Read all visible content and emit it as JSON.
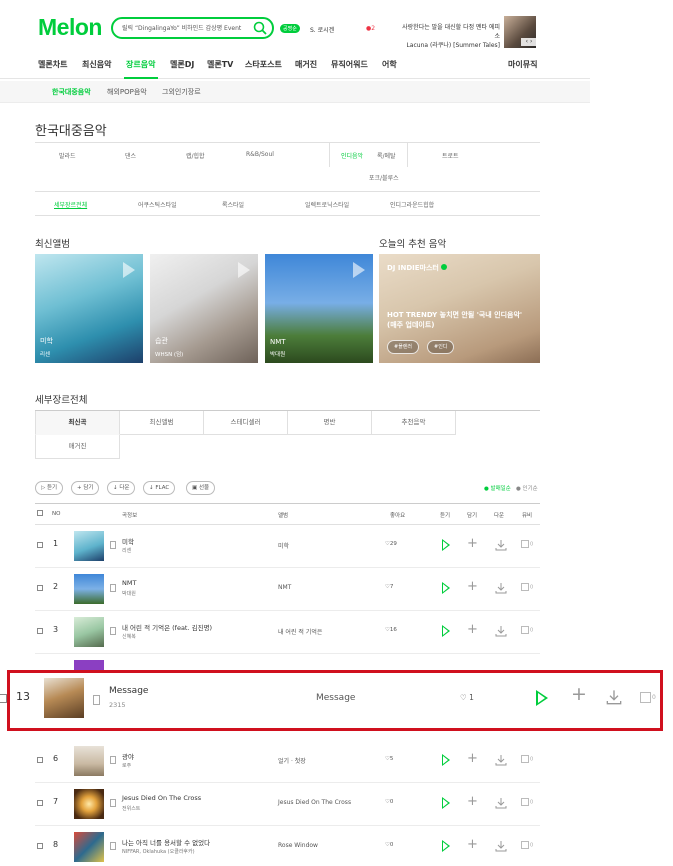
{
  "header": {
    "logo": "Melon",
    "search_placeholder": "릴릭 “DingalingaYo” 비하인드 감상평 Event",
    "badge": "공명순",
    "status_text": "S. 로시겐",
    "dot_text": "●2",
    "promo_line1": "사랑한다는 말을 대신할 다정 멘타 에피소",
    "promo_line2": "Lacuna (라쿠나) [Summer Tales]",
    "promo_nav": "‹ ›"
  },
  "gnb": [
    {
      "label": "멜론차트"
    },
    {
      "label": "최신음악"
    },
    {
      "label": "장르음악"
    },
    {
      "label": "멜론DJ"
    },
    {
      "label": "멜론TV"
    },
    {
      "label": "스타포스트"
    },
    {
      "label": "매거진"
    },
    {
      "label": "뮤직어워드"
    },
    {
      "label": "어학"
    },
    {
      "label": "마이뮤직"
    }
  ],
  "subnav": [
    {
      "label": "한국대중음악"
    },
    {
      "label": "해외POP음악"
    },
    {
      "label": "그외인기장르"
    }
  ],
  "page_title": "한국대중음악",
  "genres_row1": [
    "발라드",
    "댄스",
    "랩/힙합",
    "R&B/Soul",
    "인디음악",
    "록/메탈",
    "트로트"
  ],
  "genres_row2": [
    "포크/블루스"
  ],
  "detail_genres": [
    "세부장르전체",
    "어쿠스틱스타일",
    "록스타일",
    "일렉트로닉스타일",
    "인디그라운드힙합"
  ],
  "new_albums": {
    "title": "최신앨범",
    "items": [
      {
        "title": "미학",
        "artist": "리센"
      },
      {
        "title": "습관",
        "artist": "WHSN (덤)"
      },
      {
        "title": "NMT",
        "artist": "박대원"
      }
    ]
  },
  "recommend": {
    "title": "오늘의 추천 음악",
    "dj": "DJ INDIE마스터",
    "text_line1": "HOT TRENDY 놓치면 안될 '국내 인디음악'",
    "text_line2": "(매주 업데이트)",
    "tag1": "#플렌러",
    "tag2": "#인디"
  },
  "sub_genre": {
    "title": "세부장르전체",
    "tabs": [
      "최신곡",
      "최신앨범",
      "스테디셀러",
      "명반",
      "추천음악",
      "매거진"
    ]
  },
  "toolbar": {
    "buttons": [
      "▷ 듣기",
      "+ 담기",
      "↓ 다운",
      "↓ FLAC",
      "▣ 선물"
    ],
    "sort_popular": "● 발매일순",
    "sort_name": "● 인기순"
  },
  "table": {
    "headers": {
      "no": "NO",
      "song": "곡정보",
      "album": "앨범",
      "like": "좋아요",
      "listen": "듣기",
      "add": "담기",
      "download": "다운",
      "mv": "뮤비"
    },
    "rows": [
      {
        "no": "1",
        "title": "미학",
        "artist": "리센",
        "album": "미학",
        "likes": "♡29"
      },
      {
        "no": "2",
        "title": "NMT",
        "artist": "박대원",
        "album": "NMT",
        "likes": "♡7"
      },
      {
        "no": "3",
        "title": "내 어린 적 기억은 (feat. 김진명)",
        "artist": "신혜복",
        "album": "내 어린 적 기억은",
        "likes": "♡16"
      },
      {
        "no": "6",
        "title": "광야",
        "artist": "로주",
        "album": "얼기 · 첫장",
        "likes": "♡5"
      },
      {
        "no": "7",
        "title": "Jesus Died On The Cross",
        "artist": "전위스트",
        "album": "Jesus Died On The Cross",
        "likes": "♡0"
      },
      {
        "no": "8",
        "title": "나는 아직 너를 용서할 수 없었다",
        "artist": "NIFFAR, Oklahuka (오클라후카)",
        "album": "Rose Window",
        "likes": "♡0"
      }
    ],
    "mv_count": "0",
    "highlight": {
      "no": "13",
      "title": "Message",
      "artist": "2315",
      "album": "Message",
      "likes": "♡ 1",
      "mv_count": "0"
    }
  },
  "colors": {
    "brand": "#00cd3c",
    "highlight_border": "#d0101e"
  }
}
